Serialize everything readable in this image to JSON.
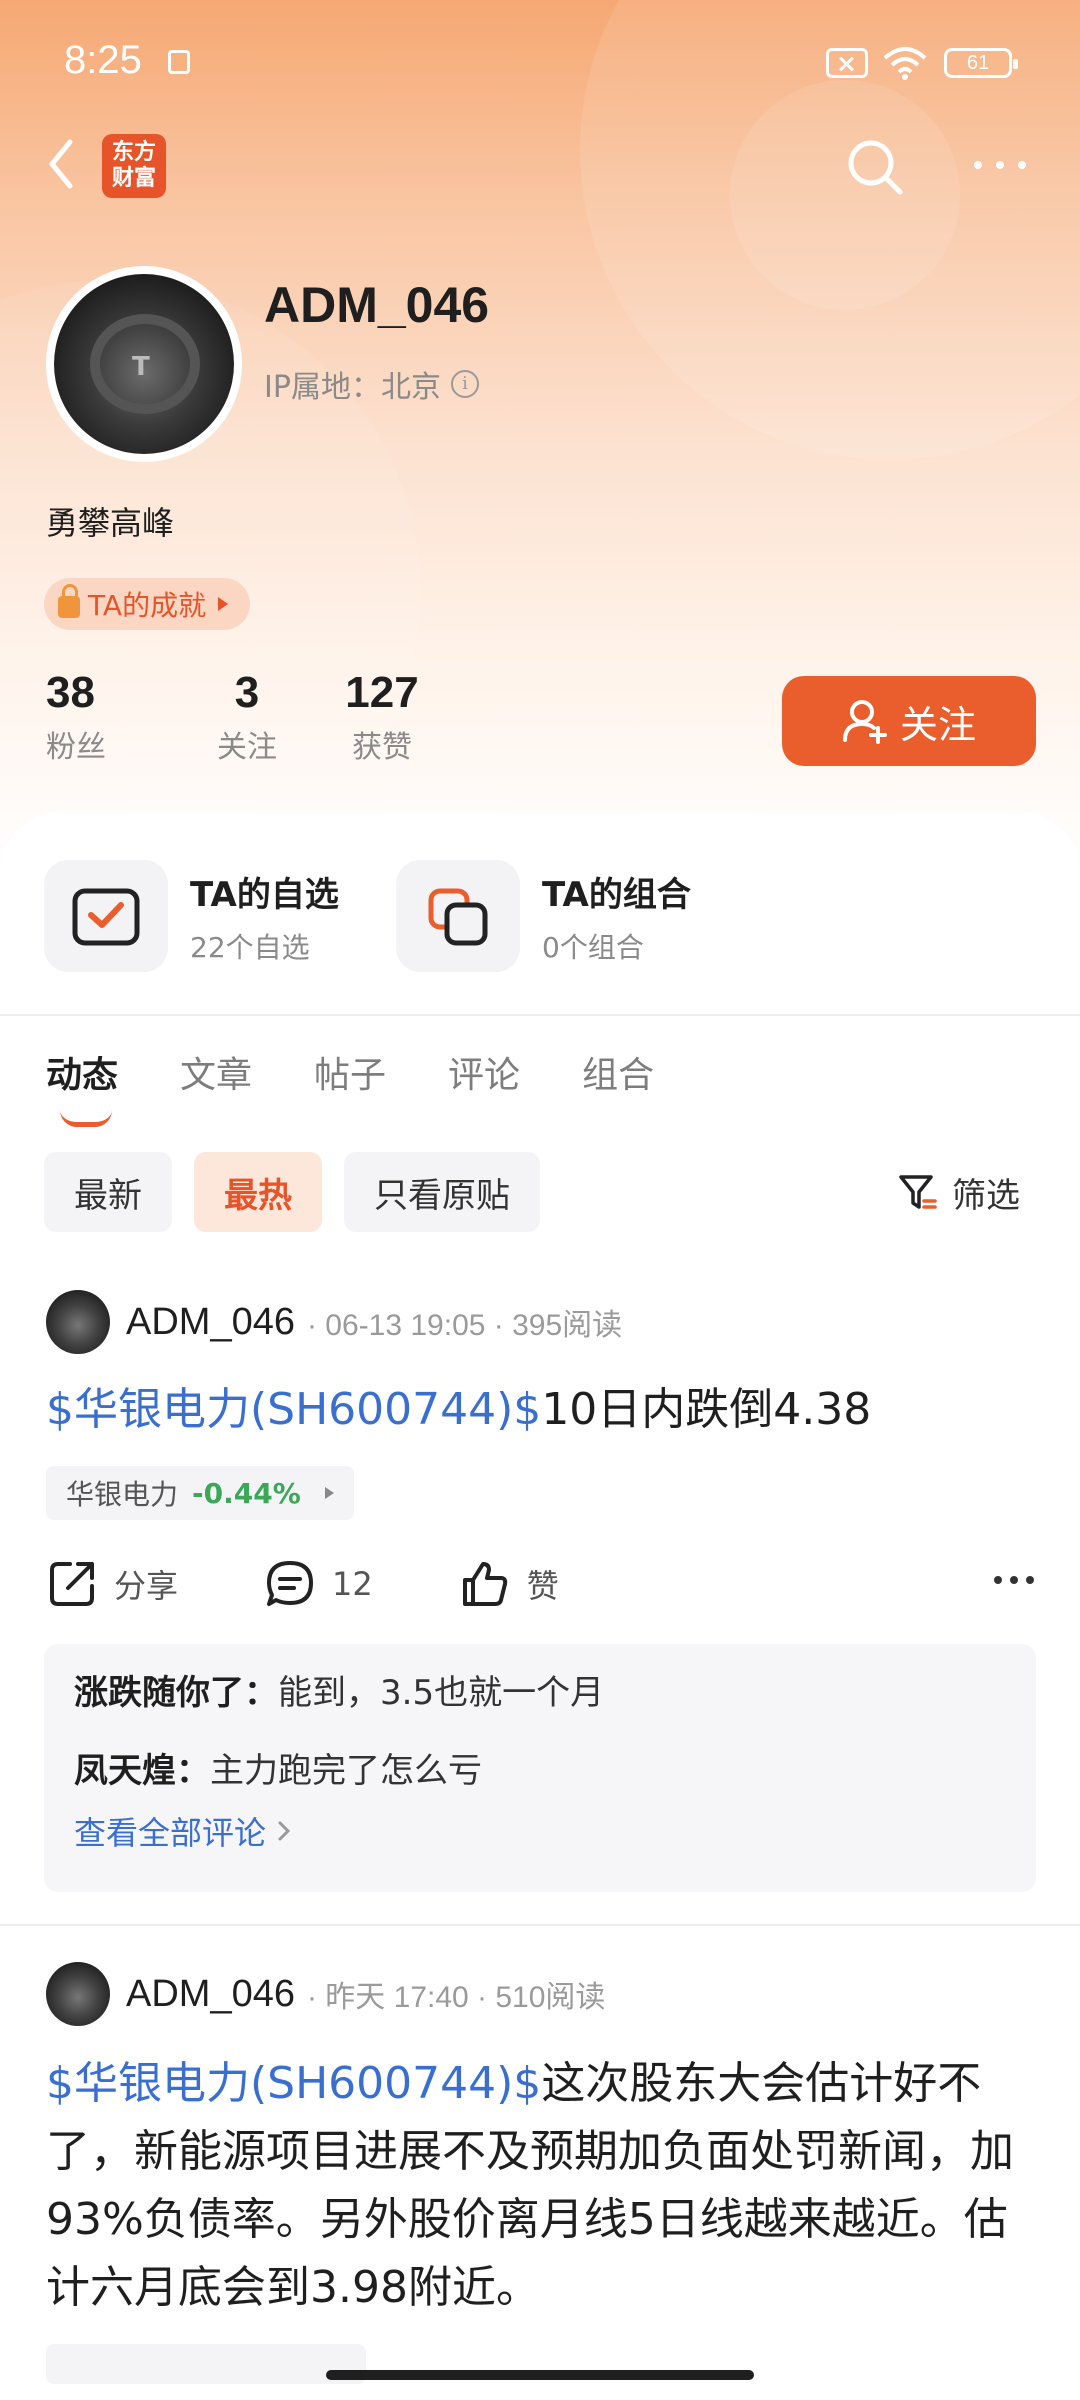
{
  "status_bar": {
    "time": "8:25",
    "battery": "61"
  },
  "nav": {
    "logo_text": "东方财富"
  },
  "profile": {
    "username": "ADM_046",
    "ip_label": "IP属地：北京",
    "bio": "勇攀高峰",
    "achievement": "TA的成就",
    "stats": [
      {
        "num": "38",
        "label": "粉丝"
      },
      {
        "num": "3",
        "label": "关注"
      },
      {
        "num": "127",
        "label": "获赞"
      }
    ],
    "follow_label": "关注"
  },
  "tiles": [
    {
      "title": "TA的自选",
      "sub": "22个自选"
    },
    {
      "title": "TA的组合",
      "sub": "0个组合"
    }
  ],
  "tabs": [
    "动态",
    "文章",
    "帖子",
    "评论",
    "组合"
  ],
  "filters": [
    "最新",
    "最热",
    "只看原贴"
  ],
  "screen_label": "筛选",
  "posts": [
    {
      "author": "ADM_046",
      "meta": "· 06-13 19:05 · 395阅读",
      "stock_link": "$华银电力(SH600744)$",
      "text": "10日内跌倒4.38",
      "tag_name": "华银电力",
      "tag_change": "-0.44%",
      "share": "分享",
      "comment_count": "12",
      "like": "赞",
      "comments": [
        {
          "user": "涨跌随你了：",
          "text": "能到，3.5也就一个月"
        },
        {
          "user": "凤天煌：",
          "text": "主力跑完了怎么亏"
        }
      ],
      "view_all": "查看全部评论"
    },
    {
      "author": "ADM_046",
      "meta": "· 昨天 17:40 · 510阅读",
      "stock_link": "$华银电力(SH600744)$",
      "text": "这次股东大会估计好不了，新能源项目进展不及预期加负面处罚新闻，加93%负债率。另外股价离月线5日线越来越近。估计六月底会到3.98附近。"
    }
  ]
}
